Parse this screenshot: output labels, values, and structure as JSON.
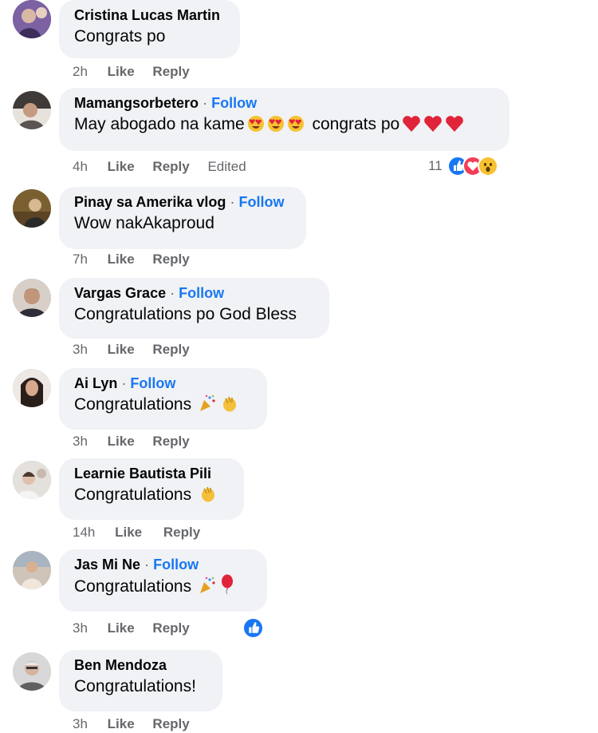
{
  "comments": [
    {
      "name": "Cristina Lucas Martin",
      "follow": "",
      "text": "Congrats po",
      "time": "2h",
      "like": "Like",
      "reply": "Reply",
      "edited": "",
      "avatar_color": "#6a4f8a"
    },
    {
      "name": "Mamangsorbetero",
      "follow": "Follow",
      "text": "May abogado na kame",
      "text2": " congrats po",
      "time": "4h",
      "like": "Like",
      "reply": "Reply",
      "edited": "Edited",
      "reaction_count": "11",
      "reactions": [
        "like",
        "love",
        "wow"
      ],
      "avatar_color": "#4c4440"
    },
    {
      "name": "Pinay sa Amerika vlog",
      "follow": "Follow",
      "text": "Wow nakAkaproud",
      "time": "7h",
      "like": "Like",
      "reply": "Reply",
      "edited": "",
      "avatar_color": "#8a6e3a"
    },
    {
      "name": "Vargas Grace",
      "follow": "Follow",
      "text": "Congratulations po God Bless",
      "time": "3h",
      "like": "Like",
      "reply": "Reply",
      "edited": "",
      "avatar_color": "#b8a79a"
    },
    {
      "name": "Ai Lyn",
      "follow": "Follow",
      "text": "Congratulations",
      "time": "3h",
      "like": "Like",
      "reply": "Reply",
      "edited": "",
      "emojis": [
        "party-popper",
        "clapping-hands"
      ],
      "avatar_color": "#3b2a24"
    },
    {
      "name": "Learnie Bautista Pili",
      "follow": "",
      "text": "Congratulations",
      "time": "14h",
      "like": "Like",
      "reply": "Reply",
      "edited": "",
      "emojis": [
        "clapping-hands"
      ],
      "avatar_color": "#d8d4d0"
    },
    {
      "name": "Jas Mi Ne",
      "follow": "Follow",
      "text": "Congratulations",
      "time": "3h",
      "like": "Like",
      "reply": "Reply",
      "edited": "",
      "emojis": [
        "party-popper",
        "balloon"
      ],
      "reactions": [
        "like"
      ],
      "avatar_color": "#a69585"
    },
    {
      "name": "Ben Mendoza",
      "follow": "",
      "text": "Congratulations!",
      "time": "3h",
      "like": "Like",
      "reply": "Reply",
      "edited": "",
      "avatar_color": "#8f8f8f"
    }
  ],
  "separator": "·"
}
